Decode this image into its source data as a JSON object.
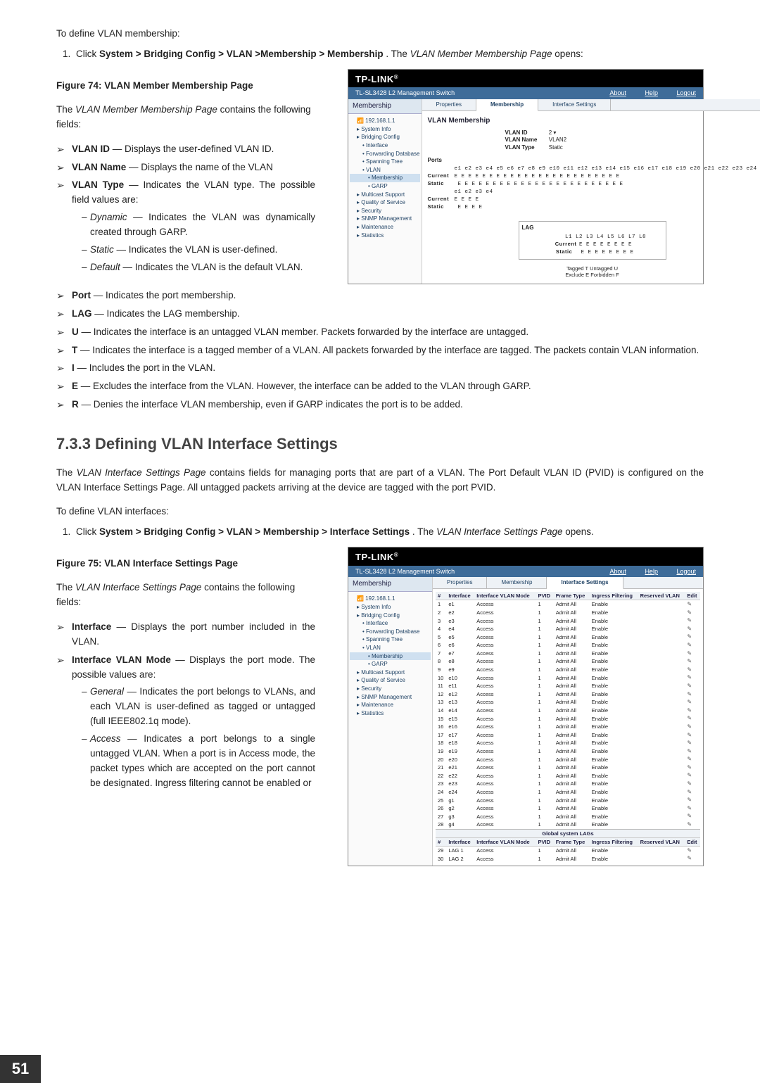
{
  "page_number": "51",
  "section1": {
    "intro": "To define VLAN membership:",
    "step_prefix": "Click ",
    "step_path": "System > Bridging Config > VLAN >Membership > Membership",
    "step_mid": ". The ",
    "step_page": "VLAN Member Membership Page",
    "step_end": " opens:",
    "fig_caption": "Figure 74: VLAN Member Membership Page",
    "contains": "The VLAN Member Membership Page contains the following fields:",
    "fields": [
      {
        "term": "VLAN ID",
        "desc": "Displays the user-defined VLAN ID."
      },
      {
        "term": "VLAN Name",
        "desc": "Displays the name of the VLAN"
      },
      {
        "term": "VLAN Type",
        "desc": "Indicates the VLAN type. The possible field values are:",
        "sub": [
          {
            "term": "Dynamic",
            "desc": "Indicates the VLAN was dynamically created through GARP."
          },
          {
            "term": "Static",
            "desc": "Indicates the VLAN is user-defined."
          },
          {
            "term": "Default",
            "desc": "Indicates the VLAN is the default VLAN."
          }
        ]
      },
      {
        "term": "Port",
        "desc": "Indicates the port membership."
      },
      {
        "term": "LAG",
        "desc": "Indicates the LAG membership."
      },
      {
        "term": "U",
        "desc": "Indicates the interface is an untagged VLAN member. Packets forwarded by the interface are untagged."
      },
      {
        "term": "T",
        "desc": "Indicates the interface is a tagged member of a VLAN. All packets forwarded by the interface are tagged. The packets contain VLAN information."
      },
      {
        "term": "I",
        "desc": "Includes the port in the VLAN."
      },
      {
        "term": "E",
        "desc": "Excludes the interface from the VLAN. However, the interface can be added to the VLAN through GARP."
      },
      {
        "term": "R",
        "desc": "Denies the interface VLAN membership, even if GARP indicates the port is to be added."
      }
    ]
  },
  "figure74": {
    "brand": "TP-LINK",
    "device": "TL-SL3428 L2 Management Switch",
    "links": [
      "About",
      "Help",
      "Logout"
    ],
    "sidebar_title": "Membership",
    "tree_root": "192.168.1.1",
    "tree": [
      "System Info",
      "Bridging Config",
      "  Interface",
      "  Forwarding Database",
      "  Spanning Tree",
      "  VLAN",
      "    Membership",
      "    GARP",
      "Multicast Support",
      "Quality of Service",
      "Security",
      "SNMP Management",
      "Maintenance",
      "Statistics"
    ],
    "tabs": [
      "Properties",
      "Membership",
      "Interface Settings"
    ],
    "active_tab": "Membership",
    "main_heading": "VLAN Membership",
    "kv": [
      {
        "k": "VLAN ID",
        "v": "2 ▾"
      },
      {
        "k": "VLAN Name",
        "v": "VLAN2"
      },
      {
        "k": "VLAN Type",
        "v": "Static"
      }
    ],
    "ports_label": "Ports",
    "port_header": "e1 e2 e3 e4 e5 e6 e7 e8 e9 e10 e11 e12 e13 e14 e15 e16 e17 e18 e19 e20 e21 e22 e23 e24",
    "port_current": "E  E  E  E  E  E  E  E  E  E   E   E   E   E   E   E   E   E   E   E   E   E   E   E",
    "port_static": " E  E  E  E  E  E  E  E  E  E   E   E   E   E   E   E   E   E   E   E   E   E   E   E",
    "port_header2": "e1 e2 e3 e4",
    "port_current2": "E  E  E  E",
    "port_static2": " E  E  E  E",
    "lag_title": "LAG",
    "lag_header": "L1 L2 L3 L4 L5 L6 L7 L8",
    "lag_current": "E  E  E  E  E  E  E  E",
    "lag_static": " E  E  E  E  E  E  E  E",
    "legend1": "Tagged  T  Untagged  U",
    "legend2": "Exclude  E  Forbidden  F"
  },
  "section2": {
    "heading": "7.3.3 Defining VLAN Interface Settings",
    "para": "The VLAN Interface Settings Page contains fields for managing ports that are part of a VLAN. The Port Default VLAN ID (PVID) is configured on the VLAN Interface Settings Page. All untagged packets arriving at the device are tagged with the port PVID.",
    "intro": "To define VLAN interfaces:",
    "step_prefix": "Click ",
    "step_path": "System > Bridging Config > VLAN > Membership > Interface Settings",
    "step_mid": ". The ",
    "step_page": "VLAN Interface Settings Page",
    "step_end": " opens.",
    "fig_caption": "Figure 75: VLAN Interface Settings Page",
    "contains": "The VLAN Interface Settings Page contains the following fields:",
    "fields": [
      {
        "term": "Interface",
        "desc": "Displays the port number included in the VLAN."
      },
      {
        "term": "Interface VLAN Mode",
        "desc": "Displays the port mode. The possible values are:",
        "sub": [
          {
            "term": "General",
            "desc": "Indicates the port belongs to VLANs, and each VLAN is user-defined as tagged or untagged (full IEEE802.1q mode)."
          },
          {
            "term": "Access",
            "desc": "Indicates a port belongs to a single untagged VLAN. When a port is in Access mode, the packet types which are accepted on the port cannot be designated. Ingress filtering cannot be enabled or"
          }
        ]
      }
    ]
  },
  "figure75": {
    "brand": "TP-LINK",
    "device": "TL-SL3428 L2 Management Switch",
    "links": [
      "About",
      "Help",
      "Logout"
    ],
    "sidebar_title": "Membership",
    "tree_root": "192.168.1.1",
    "tabs": [
      "Properties",
      "Membership",
      "Interface Settings"
    ],
    "active_tab": "Interface Settings",
    "columns": [
      "#",
      "Interface",
      "Interface VLAN Mode",
      "PVID",
      "Frame Type",
      "Ingress Filtering",
      "Reserved VLAN",
      "Edit"
    ],
    "rows": [
      [
        "1",
        "e1",
        "Access",
        "1",
        "Admit All",
        "Enable",
        "",
        ""
      ],
      [
        "2",
        "e2",
        "Access",
        "1",
        "Admit All",
        "Enable",
        "",
        ""
      ],
      [
        "3",
        "e3",
        "Access",
        "1",
        "Admit All",
        "Enable",
        "",
        ""
      ],
      [
        "4",
        "e4",
        "Access",
        "1",
        "Admit All",
        "Enable",
        "",
        ""
      ],
      [
        "5",
        "e5",
        "Access",
        "1",
        "Admit All",
        "Enable",
        "",
        ""
      ],
      [
        "6",
        "e6",
        "Access",
        "1",
        "Admit All",
        "Enable",
        "",
        ""
      ],
      [
        "7",
        "e7",
        "Access",
        "1",
        "Admit All",
        "Enable",
        "",
        ""
      ],
      [
        "8",
        "e8",
        "Access",
        "1",
        "Admit All",
        "Enable",
        "",
        ""
      ],
      [
        "9",
        "e9",
        "Access",
        "1",
        "Admit All",
        "Enable",
        "",
        ""
      ],
      [
        "10",
        "e10",
        "Access",
        "1",
        "Admit All",
        "Enable",
        "",
        ""
      ],
      [
        "11",
        "e11",
        "Access",
        "1",
        "Admit All",
        "Enable",
        "",
        ""
      ],
      [
        "12",
        "e12",
        "Access",
        "1",
        "Admit All",
        "Enable",
        "",
        ""
      ],
      [
        "13",
        "e13",
        "Access",
        "1",
        "Admit All",
        "Enable",
        "",
        ""
      ],
      [
        "14",
        "e14",
        "Access",
        "1",
        "Admit All",
        "Enable",
        "",
        ""
      ],
      [
        "15",
        "e15",
        "Access",
        "1",
        "Admit All",
        "Enable",
        "",
        ""
      ],
      [
        "16",
        "e16",
        "Access",
        "1",
        "Admit All",
        "Enable",
        "",
        ""
      ],
      [
        "17",
        "e17",
        "Access",
        "1",
        "Admit All",
        "Enable",
        "",
        ""
      ],
      [
        "18",
        "e18",
        "Access",
        "1",
        "Admit All",
        "Enable",
        "",
        ""
      ],
      [
        "19",
        "e19",
        "Access",
        "1",
        "Admit All",
        "Enable",
        "",
        ""
      ],
      [
        "20",
        "e20",
        "Access",
        "1",
        "Admit All",
        "Enable",
        "",
        ""
      ],
      [
        "21",
        "e21",
        "Access",
        "1",
        "Admit All",
        "Enable",
        "",
        ""
      ],
      [
        "22",
        "e22",
        "Access",
        "1",
        "Admit All",
        "Enable",
        "",
        ""
      ],
      [
        "23",
        "e23",
        "Access",
        "1",
        "Admit All",
        "Enable",
        "",
        ""
      ],
      [
        "24",
        "e24",
        "Access",
        "1",
        "Admit All",
        "Enable",
        "",
        ""
      ],
      [
        "25",
        "g1",
        "Access",
        "1",
        "Admit All",
        "Enable",
        "",
        ""
      ],
      [
        "26",
        "g2",
        "Access",
        "1",
        "Admit All",
        "Enable",
        "",
        ""
      ],
      [
        "27",
        "g3",
        "Access",
        "1",
        "Admit All",
        "Enable",
        "",
        ""
      ],
      [
        "28",
        "g4",
        "Access",
        "1",
        "Admit All",
        "Enable",
        "",
        ""
      ]
    ],
    "syslag_label": "Global system LAGs",
    "lag_rows": [
      [
        "29",
        "LAG 1",
        "Access",
        "1",
        "Admit All",
        "Enable",
        "",
        ""
      ],
      [
        "30",
        "LAG 2",
        "Access",
        "1",
        "Admit All",
        "Enable",
        "",
        ""
      ]
    ]
  }
}
